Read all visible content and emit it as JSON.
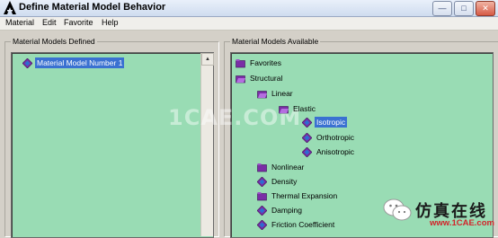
{
  "window": {
    "title": "Define Material Model Behavior"
  },
  "menu": [
    "Material",
    "Edit",
    "Favorite",
    "Help"
  ],
  "left": {
    "group_label": "Material Models Defined",
    "items": [
      {
        "label": "Material Model Number 1",
        "selected": true
      }
    ]
  },
  "right": {
    "group_label": "Material Models Available",
    "items": [
      {
        "label": "Favorites",
        "icon": "folder-icon"
      },
      {
        "label": "Structural",
        "icon": "folder-open-icon"
      },
      {
        "label": "Linear",
        "icon": "folder-open-icon"
      },
      {
        "label": "Elastic",
        "icon": "folder-open-icon"
      },
      {
        "label": "Isotropic",
        "icon": "material-icon",
        "selected": true
      },
      {
        "label": "Orthotropic",
        "icon": "material-icon"
      },
      {
        "label": "Anisotropic",
        "icon": "material-icon"
      },
      {
        "label": "Nonlinear",
        "icon": "folder-icon"
      },
      {
        "label": "Density",
        "icon": "material-icon"
      },
      {
        "label": "Thermal Expansion",
        "icon": "folder-icon"
      },
      {
        "label": "Damping",
        "icon": "material-icon"
      },
      {
        "label": "Friction Coefficient",
        "icon": "material-icon"
      }
    ]
  },
  "watermark": "1CAE.COM",
  "brand": {
    "text": "仿真在线",
    "url": "www.1CAE.com"
  }
}
